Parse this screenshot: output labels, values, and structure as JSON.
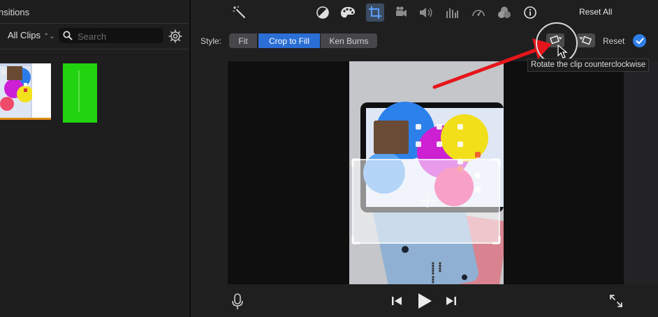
{
  "browser": {
    "panel_title": "nsitions",
    "filter_label": "All Clips",
    "search": {
      "placeholder": "Search",
      "value": ""
    }
  },
  "toolbar": {
    "tools": [
      "magic-wand-icon",
      "color-balance-icon",
      "color-correction-icon",
      "crop-icon",
      "stabilization-icon",
      "volume-icon",
      "noise-reduction-icon",
      "speed-icon",
      "clip-filter-icon",
      "info-icon"
    ],
    "selected_tool": "crop-icon",
    "reset_all_label": "Reset All"
  },
  "crop_bar": {
    "style_label": "Style:",
    "options": [
      "Fit",
      "Crop to Fill",
      "Ken Burns"
    ],
    "selected": "Crop to Fill",
    "reset_label": "Reset",
    "tooltip": "Rotate the clip counterclockwise"
  },
  "colors": {
    "accent": "#2a6ed6",
    "done": "#2e7fe8",
    "annotation": "#e5161b",
    "green_clip": "#22d40f"
  }
}
